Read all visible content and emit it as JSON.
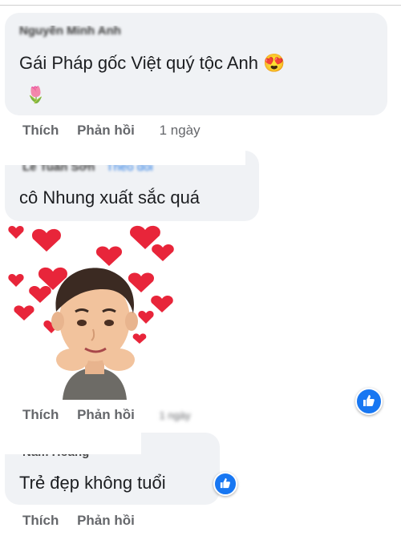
{
  "comments": [
    {
      "author": "Nguyễn Minh Anh",
      "text": "Gái Pháp gốc Việt quý tộc Anh",
      "emoji_face": "😍",
      "emoji_flower": "🌷",
      "actions": {
        "like": "Thích",
        "reply": "Phản hồi",
        "time": "1 ngày"
      }
    },
    {
      "author": "Lê Tuấn Sơn",
      "follow": "Theo dõi",
      "text": "cô Nhung xuất sắc quá",
      "actions": {
        "like": "Thích",
        "reply": "Phản hồi",
        "time": "1 ngày"
      }
    },
    {
      "author": "Nam Hoàng",
      "text": "Trẻ đẹp không tuổi",
      "actions": {
        "like": "Thích",
        "reply": "Phản hồi"
      }
    }
  ],
  "colors": {
    "bubble": "#f0f2f5",
    "like_blue": "#1877f2",
    "heart_red": "#e8253a"
  },
  "icons": {
    "reaction": "like-thumb-icon",
    "sticker": "avatar-hearts-sticker"
  }
}
